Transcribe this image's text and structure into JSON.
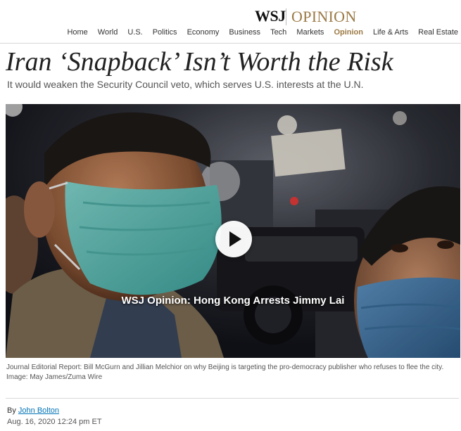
{
  "masthead": {
    "brand": "WSJ",
    "section": "OPINION"
  },
  "nav": {
    "items": [
      "Home",
      "World",
      "U.S.",
      "Politics",
      "Economy",
      "Business",
      "Tech",
      "Markets",
      "Opinion",
      "Life & Arts",
      "Real Estate"
    ],
    "active": "Opinion"
  },
  "article": {
    "headline": "Iran ‘Snapback’ Isn’t Worth the Risk",
    "dek": "It would weaken the Security Council veto, which serves U.S. interests at the U.N.",
    "byline_prefix": "By",
    "author": "John Bolton",
    "date": "Aug. 16, 2020 12:24 pm ET"
  },
  "video": {
    "title": "WSJ Opinion: Hong Kong Arrests Jimmy Lai",
    "play_icon": "play-icon"
  },
  "caption": {
    "text": "Journal Editorial Report: Bill McGurn and Jillian Melchior on why Beijing is targeting the pro-democracy publisher who refuses to flee the city.",
    "credit": "Image: May James/Zuma Wire"
  },
  "colors": {
    "accent": "#9c7a45",
    "link": "#0274b6"
  }
}
